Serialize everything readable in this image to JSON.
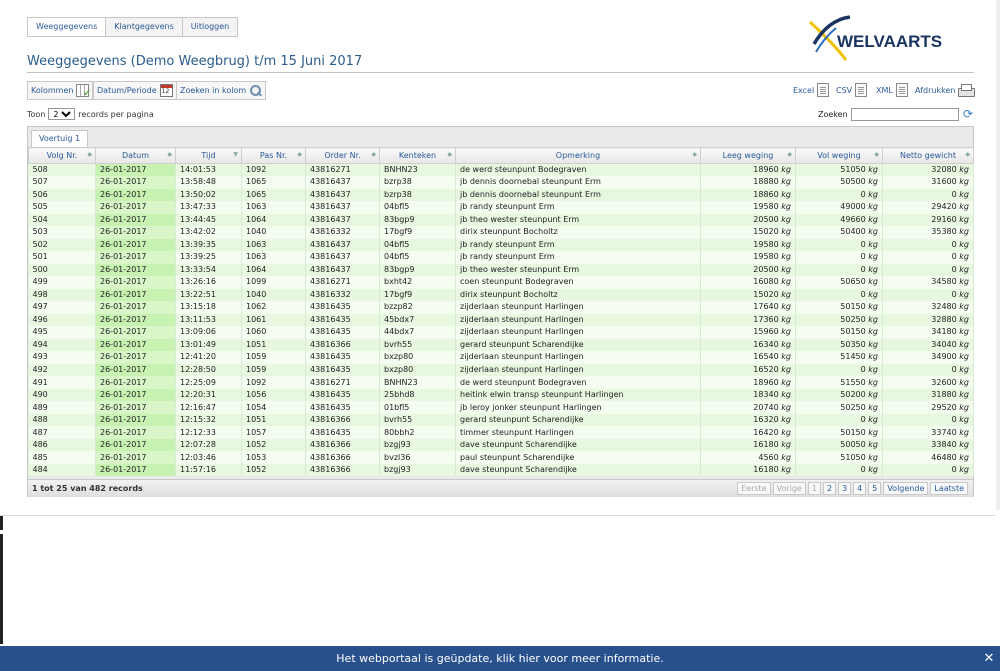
{
  "nav": {
    "tabs": [
      "Weeggegevens",
      "Klantgegevens",
      "Uitloggen"
    ]
  },
  "brand": {
    "name": "WELVAARTS",
    "colors": {
      "navy": "#1b3563",
      "yellow": "#f2c200",
      "blue": "#2b6bc4"
    }
  },
  "title": "Weeggegevens (Demo Weegbrug) t/m 15 Juni 2017",
  "toolbar": {
    "columns": "Kolommen",
    "date_period": "Datum/Periode",
    "search_column": "Zoeken in kolom",
    "excel": "Excel",
    "csv": "CSV",
    "xml": "XML",
    "print": "Afdrukken"
  },
  "length": {
    "prefix": "Toon",
    "value": "25",
    "suffix": "records per pagina"
  },
  "search": {
    "label": "Zoeken",
    "value": ""
  },
  "panel_tab": "Voertuig 1",
  "columns": [
    "Volg Nr.",
    "Datum",
    "Tijd",
    "Pas Nr.",
    "Order Nr.",
    "Kenteken",
    "Opmerking",
    "Leeg weging",
    "Vol weging",
    "Netto gewicht"
  ],
  "unit": "kg",
  "rows": [
    [
      "508",
      "26-01-2017",
      "14:01:53",
      "1092",
      "43816271",
      "BNHN23",
      "de werd steunpunt Bodegraven",
      "18960",
      "51050",
      "32080"
    ],
    [
      "507",
      "26-01-2017",
      "13:58:48",
      "1065",
      "43816437",
      "bzrp38",
      "jb dennis doornebal steunpunt Erm",
      "18880",
      "50500",
      "31600"
    ],
    [
      "506",
      "26-01-2017",
      "13:50:02",
      "1065",
      "43816437",
      "bzrp38",
      "jb dennis doornebal steunpunt Erm",
      "18860",
      "0",
      "0"
    ],
    [
      "505",
      "26-01-2017",
      "13:47:33",
      "1063",
      "43816437",
      "04bfl5",
      "jb randy steunpunt Erm",
      "19580",
      "49000",
      "29420"
    ],
    [
      "504",
      "26-01-2017",
      "13:44:45",
      "1064",
      "43816437",
      "83bgp9",
      "jb theo wester steunpunt Erm",
      "20500",
      "49660",
      "29160"
    ],
    [
      "503",
      "26-01-2017",
      "13:42:02",
      "1040",
      "43816332",
      "17bgf9",
      "dirix steunpunt Bocholtz",
      "15020",
      "50400",
      "35380"
    ],
    [
      "502",
      "26-01-2017",
      "13:39:35",
      "1063",
      "43816437",
      "04bfl5",
      "jb randy steunpunt Erm",
      "19580",
      "0",
      "0"
    ],
    [
      "501",
      "26-01-2017",
      "13:39:25",
      "1063",
      "43816437",
      "04bfl5",
      "jb randy steunpunt Erm",
      "19580",
      "0",
      "0"
    ],
    [
      "500",
      "26-01-2017",
      "13:33:54",
      "1064",
      "43816437",
      "83bgp9",
      "jb theo wester steunpunt Erm",
      "20500",
      "0",
      "0"
    ],
    [
      "499",
      "26-01-2017",
      "13:26:16",
      "1099",
      "43816271",
      "bxht42",
      "coen steunpunt Bodegraven",
      "16080",
      "50650",
      "34580"
    ],
    [
      "498",
      "26-01-2017",
      "13:22:51",
      "1040",
      "43816332",
      "17bgf9",
      "dirix steunpunt Bocholtz",
      "15020",
      "0",
      "0"
    ],
    [
      "497",
      "26-01-2017",
      "13:15:18",
      "1062",
      "43816435",
      "bzzp82",
      "zijderlaan steunpunt Harlingen",
      "17640",
      "50150",
      "32480"
    ],
    [
      "496",
      "26-01-2017",
      "13:11:53",
      "1061",
      "43816435",
      "45bdx7",
      "zijderlaan steunpunt Harlingen",
      "17360",
      "50250",
      "32880"
    ],
    [
      "495",
      "26-01-2017",
      "13:09:06",
      "1060",
      "43816435",
      "44bdx7",
      "zijderlaan steunpunt Harlingen",
      "15960",
      "50150",
      "34180"
    ],
    [
      "494",
      "26-01-2017",
      "13:01:49",
      "1051",
      "43816366",
      "bvrh55",
      "gerard steunpunt Scharendijke",
      "16340",
      "50350",
      "34040"
    ],
    [
      "493",
      "26-01-2017",
      "12:41:20",
      "1059",
      "43816435",
      "bxzp80",
      "zijderlaan steunpunt Harlingen",
      "16540",
      "51450",
      "34900"
    ],
    [
      "492",
      "26-01-2017",
      "12:28:50",
      "1059",
      "43816435",
      "bxzp80",
      "zijderlaan steunpunt Harlingen",
      "16520",
      "0",
      "0"
    ],
    [
      "491",
      "26-01-2017",
      "12:25:09",
      "1092",
      "43816271",
      "BNHN23",
      "de werd steunpunt Bodegraven",
      "18960",
      "51550",
      "32600"
    ],
    [
      "490",
      "26-01-2017",
      "12:20:31",
      "1056",
      "43816435",
      "25bhd8",
      "heitink elwin transp steunpunt Harlingen",
      "18340",
      "50200",
      "31880"
    ],
    [
      "489",
      "26-01-2017",
      "12:16:47",
      "1054",
      "43816435",
      "01bfl5",
      "jb leroy jonker steunpunt Harlingen",
      "20740",
      "50250",
      "29520"
    ],
    [
      "488",
      "26-01-2017",
      "12:15:32",
      "1051",
      "43816366",
      "bvrh55",
      "gerard steunpunt Scharendijke",
      "16320",
      "0",
      "0"
    ],
    [
      "487",
      "26-01-2017",
      "12:12:33",
      "1057",
      "43816435",
      "80bbh2",
      "timmer steunpunt Harlingen",
      "16420",
      "50150",
      "33740"
    ],
    [
      "486",
      "26-01-2017",
      "12:07:28",
      "1052",
      "43816366",
      "bzgj93",
      "dave steunpunt Scharendijke",
      "16180",
      "50050",
      "33840"
    ],
    [
      "485",
      "26-01-2017",
      "12:03:46",
      "1053",
      "43816366",
      "bvzl36",
      "paul steunpunt Scharendijke",
      "4560",
      "51050",
      "46480"
    ],
    [
      "484",
      "26-01-2017",
      "11:57:16",
      "1052",
      "43816366",
      "bzgj93",
      "dave steunpunt Scharendijke",
      "16180",
      "0",
      "0"
    ]
  ],
  "info": "1 tot 25 van 482 records",
  "pager": {
    "first": "Eerste",
    "prev": "Vorige",
    "pages": [
      "1",
      "2",
      "3",
      "4",
      "5"
    ],
    "next": "Volgende",
    "last": "Laatste"
  },
  "notice": "Het webportaal is geüpdate, klik hier voor meer informatie.",
  "icons": {
    "notice_close": "close-icon",
    "refresh": "refresh-icon"
  }
}
